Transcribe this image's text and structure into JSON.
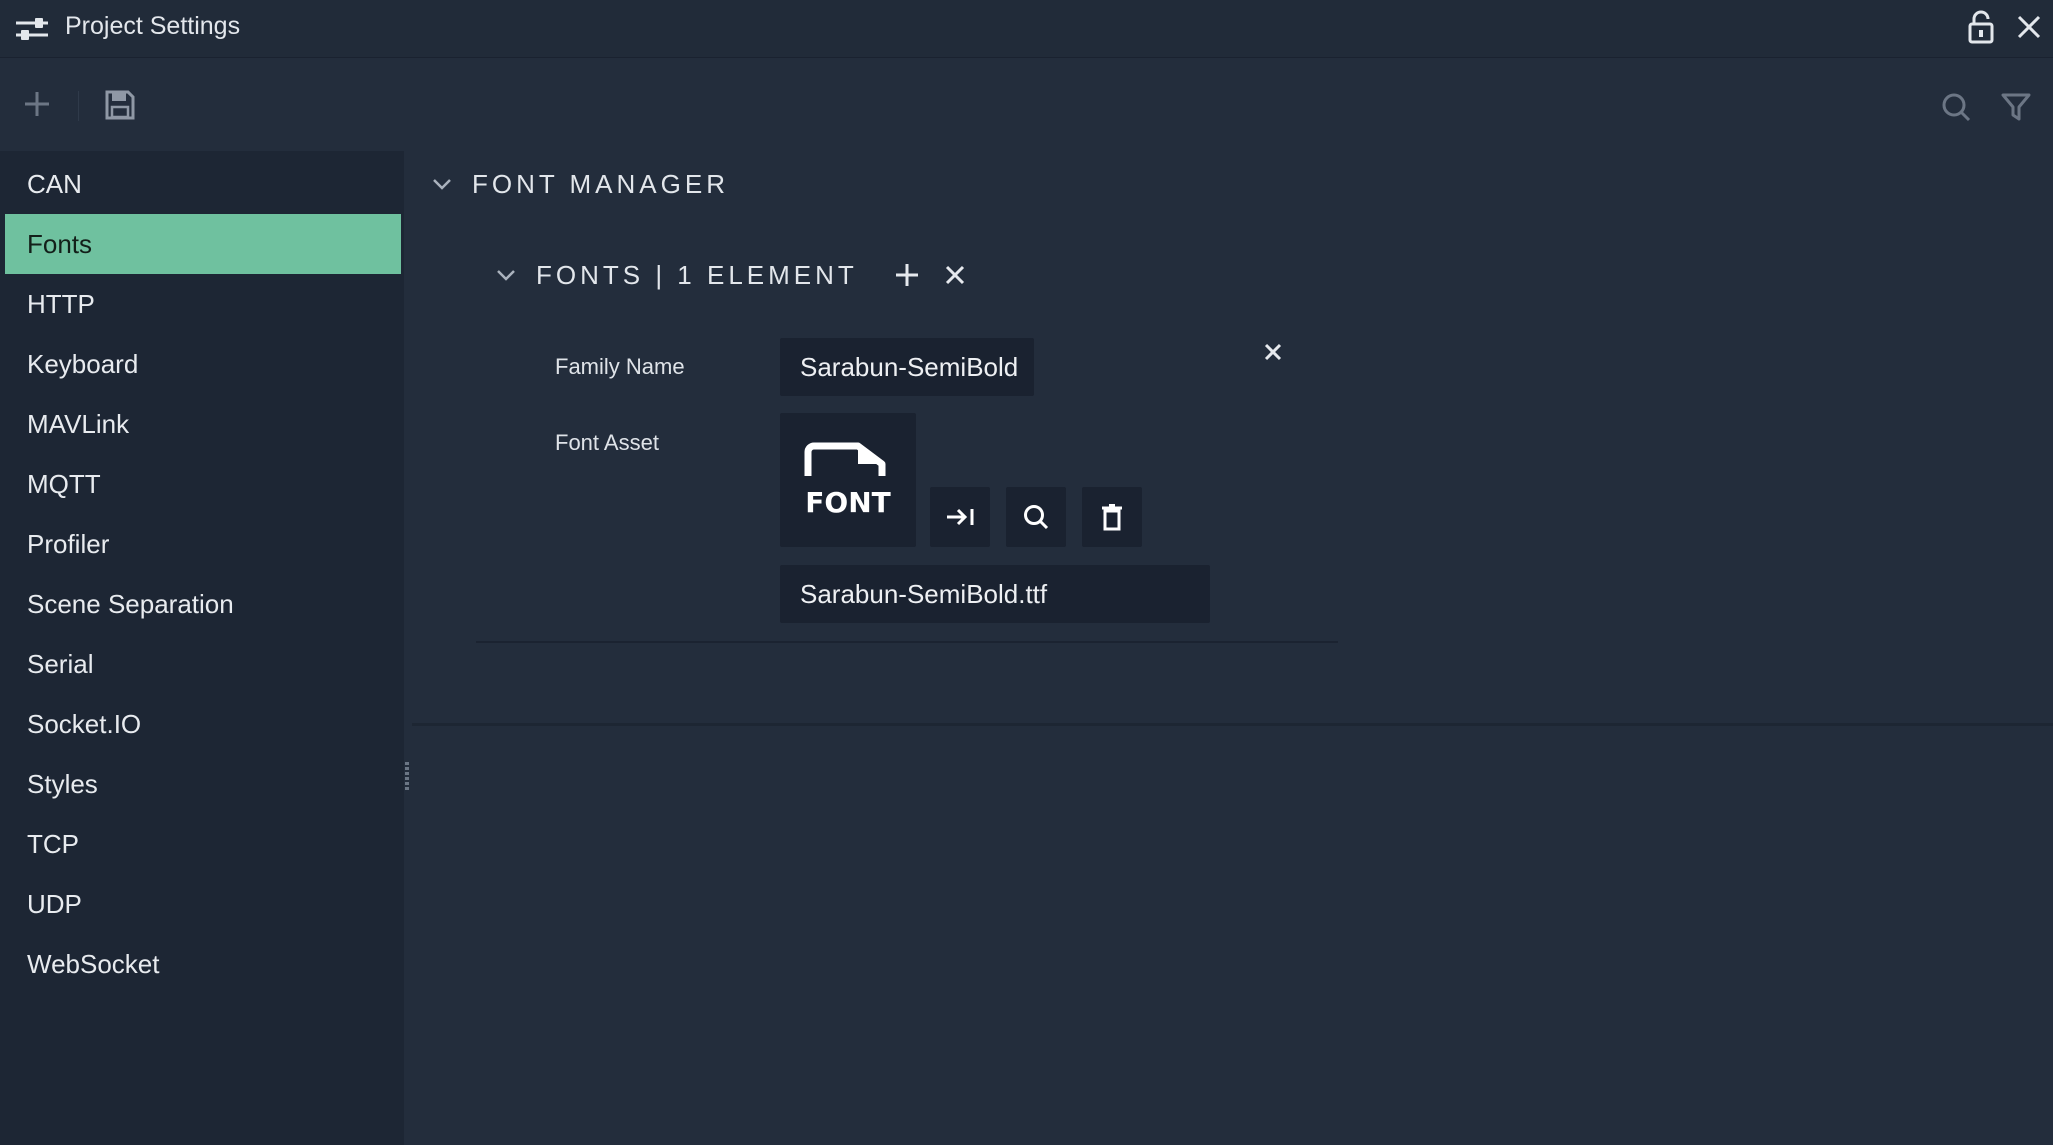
{
  "window": {
    "title": "Project Settings",
    "title_icon": "sliders-icon",
    "lock_icon": "lock-icon",
    "close_icon": "close-icon"
  },
  "toolbar": {
    "add_icon": "plus-icon",
    "save_icon": "save-icon",
    "search_icon": "search-icon",
    "filter_icon": "filter-icon"
  },
  "sidebar": {
    "selected": "Fonts",
    "items": [
      {
        "label": "CAN"
      },
      {
        "label": "Fonts"
      },
      {
        "label": "HTTP"
      },
      {
        "label": "Keyboard"
      },
      {
        "label": "MAVLink"
      },
      {
        "label": "MQTT"
      },
      {
        "label": "Profiler"
      },
      {
        "label": "Scene Separation"
      },
      {
        "label": "Serial"
      },
      {
        "label": "Socket.IO"
      },
      {
        "label": "Styles"
      },
      {
        "label": "TCP"
      },
      {
        "label": "UDP"
      },
      {
        "label": "WebSocket"
      }
    ]
  },
  "main": {
    "section_title": "FONT MANAGER",
    "fonts": {
      "title": "FONTS | 1 ELEMENT",
      "item": {
        "family_name_label": "Family Name",
        "family_name_value": "Sarabun-SemiBold",
        "font_asset_label": "Font Asset",
        "font_asset_thumb_text": "FONT",
        "font_asset_file": "Sarabun-SemiBold.ttf"
      }
    }
  },
  "colors": {
    "background": "#232d3c",
    "sidebar": "#1d2634",
    "accent_selected": "#6fc19f",
    "input_bg": "#1a2230"
  }
}
